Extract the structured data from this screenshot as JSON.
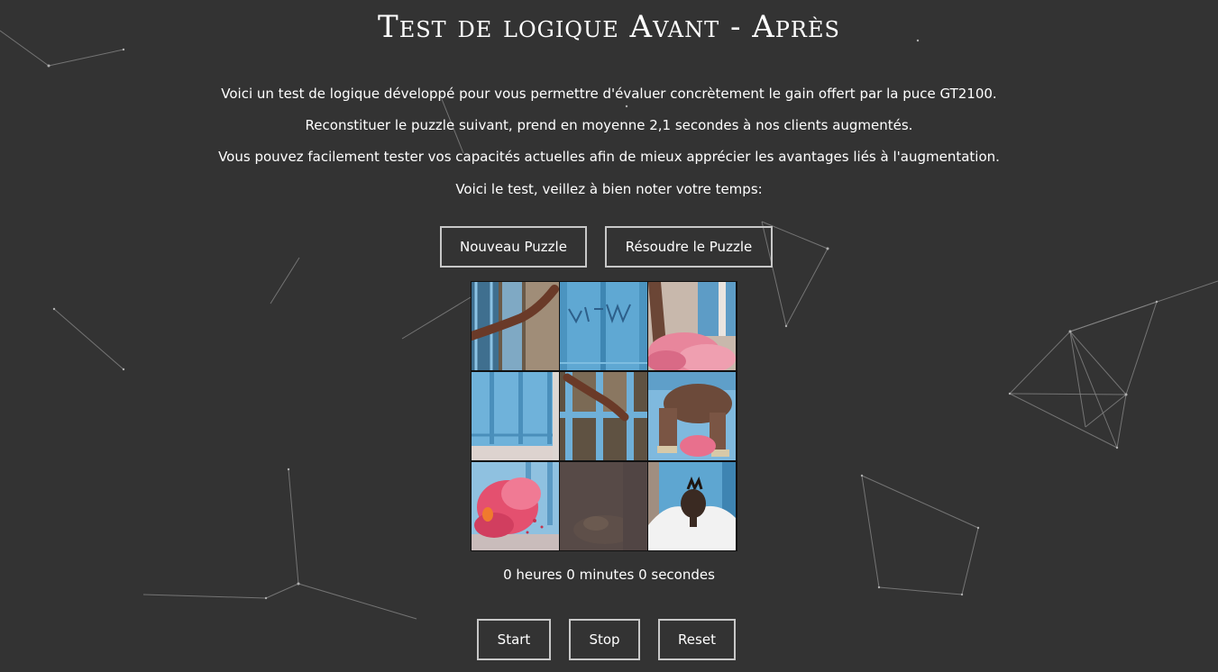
{
  "page": {
    "title": "Test de logique Avant - Après",
    "paragraphs": [
      "Voici un test de logique développé pour vous permettre d'évaluer concrètement le gain offert par la puce GT2100.",
      "Reconstituer le puzzle suivant, prend en moyenne 2,1 secondes à nos clients augmentés.",
      "Vous pouvez facilement tester vos capacités actuelles afin de mieux apprécier les avantages liés à l'augmentation.",
      "Voici le test, veillez à bien noter votre temps:"
    ]
  },
  "puzzle_controls": {
    "new_label": "Nouveau Puzzle",
    "solve_label": "Résoudre le Puzzle"
  },
  "puzzle": {
    "rows": 3,
    "cols": 3,
    "empty_tile": "row 3, column 2",
    "tiles": [
      "arm-window-tile",
      "graffiti-door-tile",
      "pink-smoke-leg-tile",
      "blue-door-tile",
      "hand-window-tile",
      "jumping-person-tile",
      "pink-smoke-tile",
      "empty-slot",
      "head-white-shirt-tile"
    ]
  },
  "timer": {
    "text": "0 heures 0 minutes 0 secondes"
  },
  "timer_controls": {
    "start_label": "Start",
    "stop_label": "Stop",
    "reset_label": "Reset"
  },
  "colors": {
    "background": "#333333",
    "text": "#ffffff",
    "button_border": "#c8c8c8",
    "photo_blue": "#5fa8d3",
    "smoke_pink": "#e85a7a"
  }
}
